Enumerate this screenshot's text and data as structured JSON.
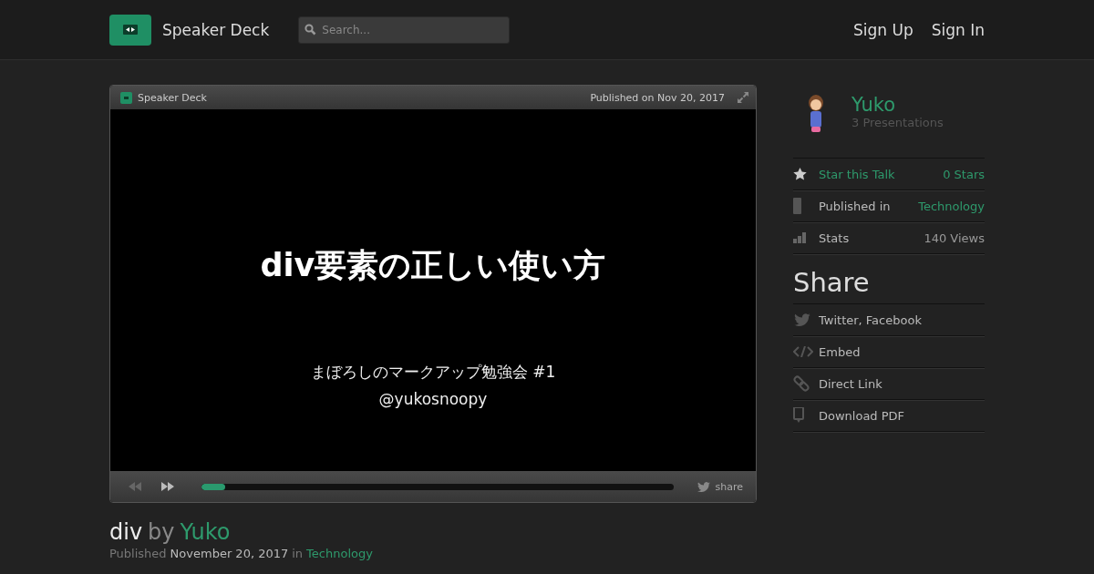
{
  "header": {
    "brand": "Speaker Deck",
    "search": {
      "placeholder": "Search..."
    },
    "nav": [
      "Sign Up",
      "Sign In"
    ]
  },
  "player": {
    "brand": "Speaker Deck",
    "published": "Published on Nov 20, 2017",
    "slide": {
      "title": "div要素の正しい使い方",
      "subtitle": "まぼろしのマークアップ勉強会 #1",
      "handle": "@yukosnoopy"
    },
    "progress": {
      "level": 0.05
    },
    "share": "share"
  },
  "talk": {
    "title": "div",
    "by": "by",
    "author": "Yuko",
    "published_label": "Published",
    "date": "November 20, 2017",
    "in": "in",
    "category": "Technology"
  },
  "sidebar": {
    "user": {
      "name": "Yuko",
      "presentations": "3 Presentations"
    },
    "info": [
      {
        "kind": "star",
        "label": "Star this Talk",
        "value": "0 Stars"
      },
      {
        "kind": "category",
        "label": "Published in",
        "value": "Technology"
      },
      {
        "kind": "stats",
        "label": "Stats",
        "value": "140 Views"
      }
    ],
    "share_heading": "Share",
    "share": [
      {
        "kind": "social",
        "label": "Twitter, Facebook"
      },
      {
        "kind": "embed",
        "label": "Embed"
      },
      {
        "kind": "link",
        "label": "Direct Link"
      },
      {
        "kind": "download",
        "label": "Download PDF"
      }
    ]
  }
}
